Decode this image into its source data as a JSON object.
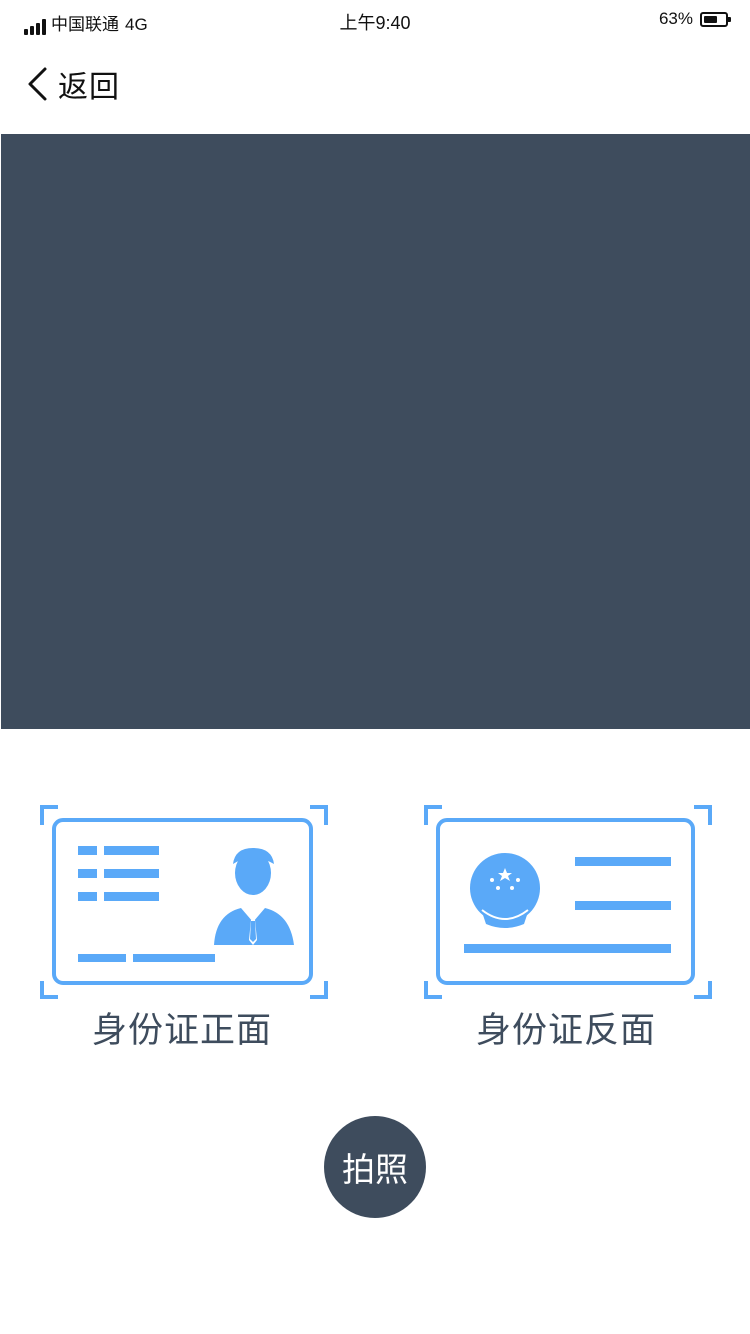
{
  "status_bar": {
    "carrier": "中国联通",
    "network": "4G",
    "time": "上午9:40",
    "battery_text": "63%",
    "battery_level": 0.63
  },
  "nav": {
    "back_label": "返回",
    "back_icon": "chevron-left-icon"
  },
  "camera": {
    "preview_color": "#3e4c5d"
  },
  "card_options": [
    {
      "label": "身份证正面",
      "icon": "id-card-front-icon"
    },
    {
      "label": "身份证反面",
      "icon": "id-card-back-icon"
    }
  ],
  "capture": {
    "label": "拍照"
  },
  "colors": {
    "accent": "#5aa9f8",
    "dark": "#3e4c5d"
  }
}
